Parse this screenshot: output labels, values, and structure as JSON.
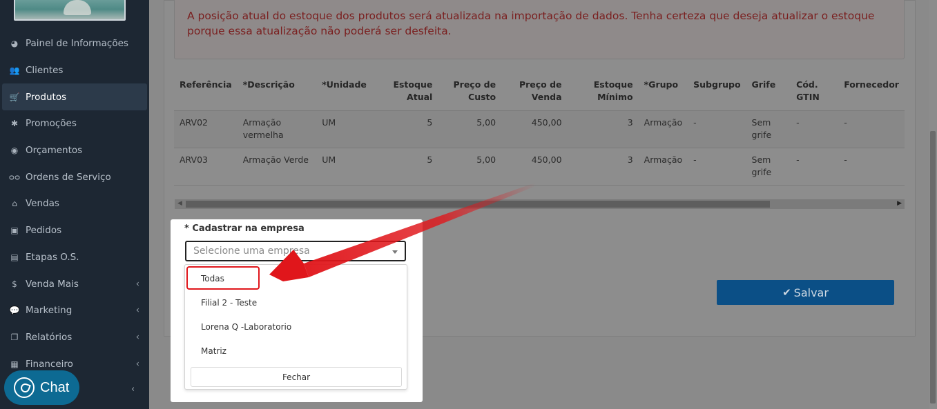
{
  "sidebar": {
    "items": [
      {
        "label": "Painel de Informações",
        "icon": "dashboard-icon",
        "glyph": "◕",
        "chevron": false
      },
      {
        "label": "Clientes",
        "icon": "users-icon",
        "glyph": "👥",
        "chevron": false
      },
      {
        "label": "Produtos",
        "icon": "cart-icon",
        "glyph": "🛒",
        "chevron": false,
        "active": true
      },
      {
        "label": "Promoções",
        "icon": "asterisk-icon",
        "glyph": "✱",
        "chevron": false
      },
      {
        "label": "Orçamentos",
        "icon": "person-badge-icon",
        "glyph": "◉",
        "chevron": false
      },
      {
        "label": "Ordens de Serviço",
        "icon": "glasses-icon",
        "glyph": "ᴑᴑ",
        "chevron": false
      },
      {
        "label": "Vendas",
        "icon": "basket-icon",
        "glyph": "⌂",
        "chevron": false
      },
      {
        "label": "Pedidos",
        "icon": "inbox-icon",
        "glyph": "▣",
        "chevron": false
      },
      {
        "label": "Etapas O.S.",
        "icon": "keyboard-icon",
        "glyph": "▤",
        "chevron": false
      },
      {
        "label": "Venda Mais",
        "icon": "dollar-icon",
        "glyph": "$",
        "chevron": true
      },
      {
        "label": "Marketing",
        "icon": "comments-icon",
        "glyph": "💬",
        "chevron": true
      },
      {
        "label": "Relatórios",
        "icon": "copy-icon",
        "glyph": "❐",
        "chevron": true
      },
      {
        "label": "Financeiro",
        "icon": "money-icon",
        "glyph": "▦",
        "chevron": true
      }
    ],
    "chevron_glyph": "‹"
  },
  "warning": {
    "text": "A posição atual do estoque dos produtos será atualizada na importação de dados. Tenha certeza que deseja atualizar o estoque porque essa atualização não poderá ser desfeita."
  },
  "table": {
    "headers": [
      "Referência",
      "*Descrição",
      "*Unidade",
      "Estoque Atual",
      "Preço de Custo",
      "Preço de Venda",
      "Estoque Mínimo",
      "*Grupo",
      "Subgrupo",
      "Grife",
      "Cód. GTIN",
      "Fornecedor"
    ],
    "rows": [
      [
        "ARV02",
        "Armação vermelha",
        "UM",
        "5",
        "5,00",
        "450,00",
        "3",
        "Armação",
        "-",
        "Sem grife",
        "-",
        "-"
      ],
      [
        "ARV03",
        "Armação Verde",
        "UM",
        "5",
        "5,00",
        "450,00",
        "3",
        "Armação",
        "-",
        "Sem grife",
        "-",
        "-"
      ]
    ]
  },
  "save_button": {
    "label": "Salvar",
    "icon": "check-icon"
  },
  "popup": {
    "label": "* Cadastrar na empresa",
    "select_placeholder": "Selecione uma empresa",
    "options": [
      "Todas",
      "Filial 2 - Teste",
      "Lorena Q -Laboratorio",
      "Matriz"
    ],
    "highlighted_option": "Todas",
    "close_label": "Fechar"
  },
  "chat": {
    "label": "Chat",
    "icon": "whatsapp-icon"
  },
  "colors": {
    "sidebar_bg": "#1d2733",
    "warning_text": "#7a1f1f",
    "save_button": "#0b4f86",
    "highlight": "#e0161b",
    "chat_bg": "#0d6a93"
  }
}
